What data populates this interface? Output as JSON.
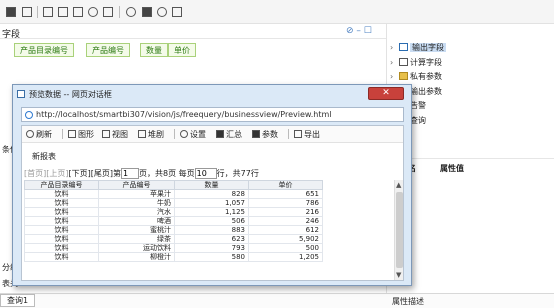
{
  "toolbar": {
    "icons": [
      "save-icon",
      "save-as-icon",
      "layout-icon",
      "table-icon",
      "chart-icon",
      "settings-icon",
      "parameters-icon",
      "search-icon",
      "sql-icon",
      "clock-icon",
      "export-icon"
    ]
  },
  "fields": {
    "label": "字段",
    "header_controls": "⊘ – ☐",
    "chips": [
      "产品目录编号",
      "产品编号",
      "数量",
      "单价"
    ]
  },
  "left_labels": {
    "condition": "条件",
    "group": "分组",
    "table": "表关"
  },
  "tree": [
    {
      "label": "输出字段",
      "arrow": "›",
      "selected": true
    },
    {
      "label": "计算字段",
      "arrow": "›",
      "selected": false
    },
    {
      "label": "私有参数",
      "arrow": "›",
      "selected": false
    },
    {
      "label": "输出参数",
      "arrow": "",
      "selected": false
    },
    {
      "label": "告警",
      "arrow": "",
      "selected": false
    },
    {
      "label": "查询",
      "arrow": "",
      "selected": false
    }
  ],
  "properties": {
    "name_header": "名",
    "value_header": "属性值"
  },
  "bottom": {
    "query_tab": "查询1",
    "prop_desc": "属性描述"
  },
  "dialog": {
    "title": "预览数据 -- 网页对话框",
    "close": "✕",
    "url": "http://localhost/smartbi307/vision/js/freequery/businessview/Preview.html",
    "toolbar": {
      "refresh": "刷新",
      "chart": "图形",
      "view": "视图",
      "stack": "堆剧",
      "settings": "设置",
      "summary": "汇总",
      "params": "参数",
      "export": "导出"
    },
    "report_title": "新报表",
    "pager": {
      "first": "[首页]",
      "prev": "[上页]",
      "next": "[下页]",
      "last": "[尾页]",
      "page_prefix": "第",
      "page_value": "1",
      "page_suffix": "页，共8页 每页",
      "per_page": "10",
      "rows_suffix": "行，共77行"
    },
    "table": {
      "headers": [
        "产品目录编号",
        "产品编号",
        "数量",
        "单价"
      ],
      "rows": [
        [
          "饮料",
          "苹果汁",
          "828",
          "651"
        ],
        [
          "饮料",
          "牛奶",
          "1,057",
          "786"
        ],
        [
          "饮料",
          "汽水",
          "1,125",
          "216"
        ],
        [
          "饮料",
          "啤酒",
          "506",
          "246"
        ],
        [
          "饮料",
          "蜜桃汁",
          "883",
          "612"
        ],
        [
          "饮料",
          "绿茶",
          "623",
          "5,902"
        ],
        [
          "饮料",
          "运动饮料",
          "793",
          "500"
        ],
        [
          "饮料",
          "柳橙汁",
          "580",
          "1,205"
        ]
      ]
    }
  }
}
